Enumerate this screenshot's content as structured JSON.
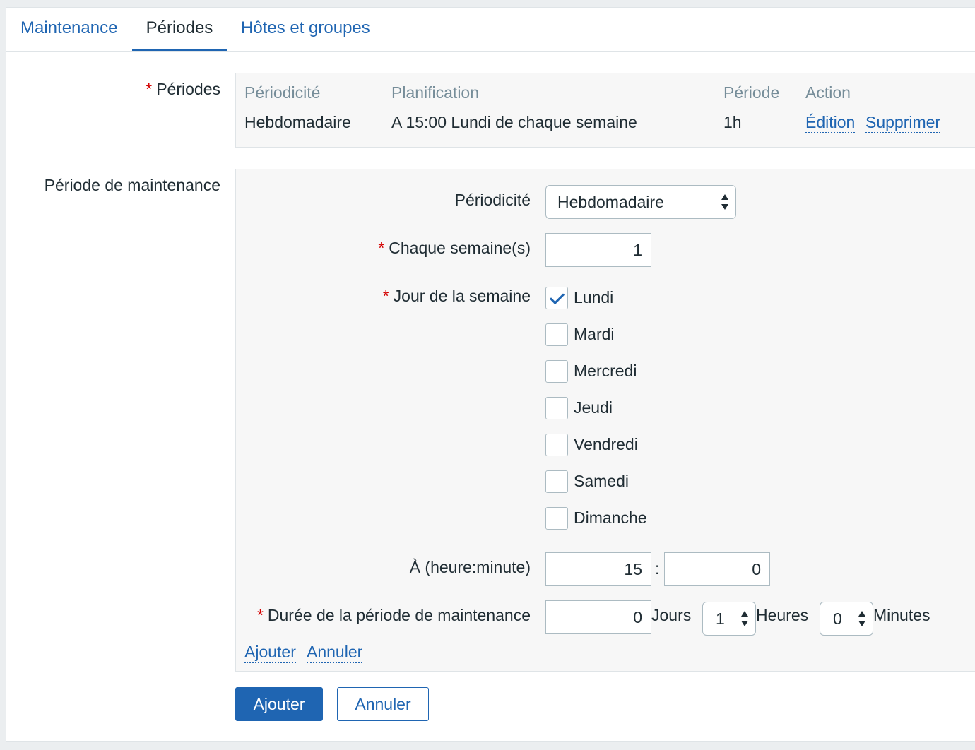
{
  "tabs": [
    {
      "label": "Maintenance"
    },
    {
      "label": "Périodes"
    },
    {
      "label": "Hôtes et groupes"
    }
  ],
  "periods_section": {
    "label": "Périodes",
    "headers": {
      "periodicity": "Périodicité",
      "schedule": "Planification",
      "period": "Période",
      "action": "Action"
    },
    "rows": [
      {
        "periodicity": "Hebdomadaire",
        "schedule": "A 15:00 Lundi de chaque semaine",
        "period": "1h",
        "edit": "Édition",
        "delete": "Supprimer"
      }
    ]
  },
  "maintenance_period": {
    "section_label": "Période de maintenance",
    "periodicity_label": "Périodicité",
    "periodicity_value": "Hebdomadaire",
    "every_week_label": "Chaque semaine(s)",
    "every_week_value": "1",
    "day_of_week_label": "Jour de la semaine",
    "days": [
      {
        "label": "Lundi",
        "checked": true
      },
      {
        "label": "Mardi",
        "checked": false
      },
      {
        "label": "Mercredi",
        "checked": false
      },
      {
        "label": "Jeudi",
        "checked": false
      },
      {
        "label": "Vendredi",
        "checked": false
      },
      {
        "label": "Samedi",
        "checked": false
      },
      {
        "label": "Dimanche",
        "checked": false
      }
    ],
    "time_label": "À (heure:minute)",
    "hour_value": "15",
    "time_separator": ":",
    "minute_value": "0",
    "duration_label": "Durée de la période de maintenance",
    "duration_days_value": "0",
    "days_unit": "Jours",
    "duration_hours_value": "1",
    "hours_unit": "Heures",
    "duration_minutes_value": "0",
    "minutes_unit": "Minutes",
    "add_link": "Ajouter",
    "cancel_link": "Annuler"
  },
  "buttons": {
    "add": "Ajouter",
    "cancel": "Annuler"
  },
  "colors": {
    "accent": "#1f65b2",
    "required": "#d40000",
    "muted_header": "#768d99"
  },
  "required_marker": "*"
}
